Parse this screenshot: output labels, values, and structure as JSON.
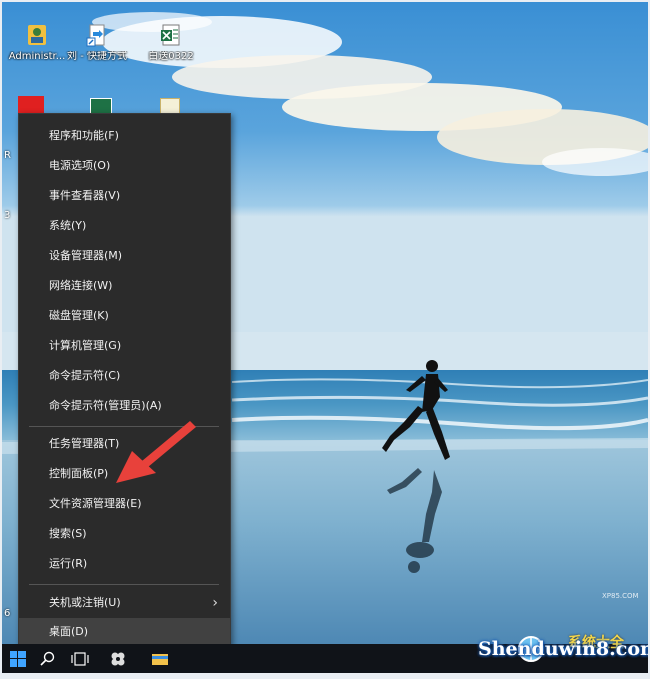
{
  "desktop": {
    "icons": [
      {
        "name": "administrator-user-icon",
        "label": "Administr..."
      },
      {
        "name": "shortcut-file-icon",
        "label": "刘 - 快捷方式"
      },
      {
        "name": "excel-file-icon",
        "label": "白送0322"
      }
    ],
    "partial_labels": {
      "r": "R",
      "three": "3",
      "hash": "6"
    }
  },
  "context_menu": {
    "items": [
      {
        "label": "程序和功能(F)"
      },
      {
        "label": "电源选项(O)"
      },
      {
        "label": "事件查看器(V)"
      },
      {
        "label": "系统(Y)"
      },
      {
        "label": "设备管理器(M)"
      },
      {
        "label": "网络连接(W)"
      },
      {
        "label": "磁盘管理(K)"
      },
      {
        "label": "计算机管理(G)"
      },
      {
        "label": "命令提示符(C)"
      },
      {
        "label": "命令提示符(管理员)(A)"
      }
    ],
    "items2": [
      {
        "label": "任务管理器(T)"
      },
      {
        "label": "控制面板(P)"
      },
      {
        "label": "文件资源管理器(E)"
      },
      {
        "label": "搜索(S)"
      },
      {
        "label": "运行(R)"
      }
    ],
    "shutdown": {
      "label": "关机或注销(U)",
      "arrow": "›"
    },
    "desktop": {
      "label": "桌面(D)"
    }
  },
  "watermark": {
    "text": "Shenduwin8.com",
    "site_small": "XP85.COM",
    "brand_partial": "系统大全"
  },
  "colors": {
    "menu_bg": "#2b2b2b",
    "menu_text": "#f2f2f2",
    "highlight": "#414141",
    "arrow": "#e8413b",
    "taskbar": "#101318"
  }
}
